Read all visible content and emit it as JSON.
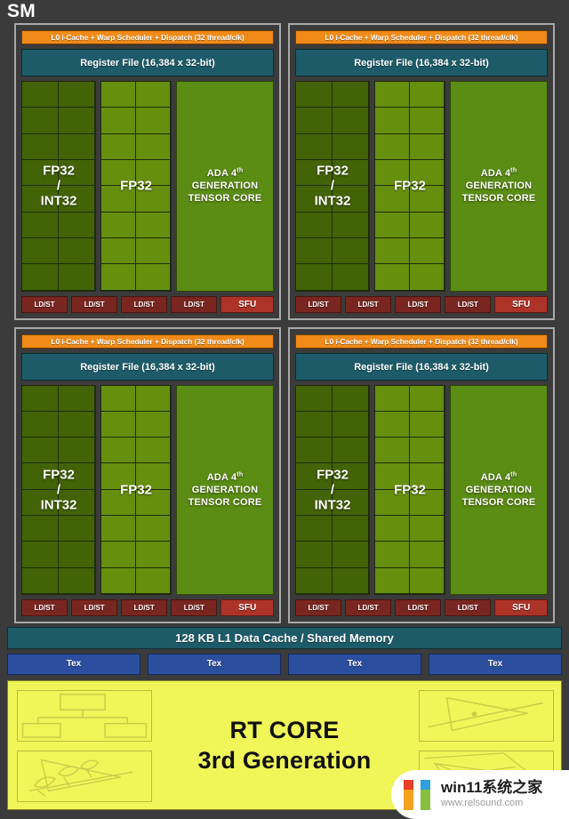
{
  "diagram": {
    "title": "SM",
    "scheduler_label": "L0 i-Cache + Warp Scheduler + Dispatch (32 thread/clk)",
    "register_file_label": "Register File (16,384 x 32-bit)",
    "fp32_int32_label_line1": "FP32",
    "fp32_int32_label_line2": "/",
    "fp32_int32_label_line3": "INT32",
    "fp32_label": "FP32",
    "tensor_core_line1_a": "ADA 4",
    "tensor_core_line1_sup": "th",
    "tensor_core_line2": "GENERATION",
    "tensor_core_line3": "TENSOR CORE",
    "ldst_label": "LD/ST",
    "sfu_label": "SFU",
    "l1_cache_label": "128 KB L1 Data Cache / Shared Memory",
    "tex_label": "Tex",
    "rt_core_line1": "RT CORE",
    "rt_core_line2": "3rd Generation",
    "processing_block_count": 4,
    "fp32_int32_cell_rows": 8,
    "fp32_int32_cell_cols": 2,
    "fp32_cell_rows": 8,
    "fp32_cell_cols": 2,
    "ldst_per_block": 4,
    "sfu_per_block": 1,
    "tex_unit_count": 4
  },
  "tex_units": [
    "Tex",
    "Tex",
    "Tex",
    "Tex"
  ],
  "ldst_units": [
    "LD/ST",
    "LD/ST",
    "LD/ST",
    "LD/ST"
  ],
  "rt_thumbnails": [
    {
      "position": "top-left",
      "icon": "bvh-tree-icon"
    },
    {
      "position": "bottom-left",
      "icon": "foliage-ray-icon"
    },
    {
      "position": "top-right",
      "icon": "ray-triangle-intersection-icon"
    },
    {
      "position": "bottom-right",
      "icon": "wireframe-mesh-icon"
    }
  ],
  "watermark": {
    "title": "win11系统之家",
    "url": "www.relsound.com"
  },
  "colors": {
    "background": "#3b3b3b",
    "quadrant_border": "#a8a8a8",
    "scheduler_orange": "#f08a18",
    "register_file_teal": "#1d5b69",
    "fp32_int32_green": "#426406",
    "fp32_green": "#668f0e",
    "tensor_core_green": "#5b8c14",
    "ldst_red": "#7a2620",
    "sfu_red": "#ad3328",
    "l1_cache_teal": "#1d5b69",
    "tex_blue": "#2b4e9e",
    "rt_core_yellow": "#f0f558"
  }
}
